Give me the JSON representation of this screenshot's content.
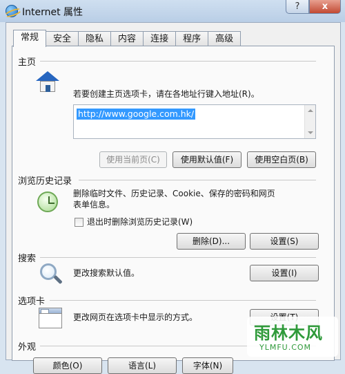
{
  "window": {
    "title": "Internet 属性"
  },
  "titlebar": {
    "help_label": "?",
    "close_label": "x"
  },
  "tabs": [
    {
      "label": "常规"
    },
    {
      "label": "安全"
    },
    {
      "label": "隐私"
    },
    {
      "label": "内容"
    },
    {
      "label": "连接"
    },
    {
      "label": "程序"
    },
    {
      "label": "高级"
    }
  ],
  "home": {
    "title": "主页",
    "description": "若要创建主页选项卡，请在各地址行键入地址(R)。",
    "url": "http://www.google.com.hk/",
    "use_current": "使用当前页(C)",
    "use_default": "使用默认值(F)",
    "use_blank": "使用空白页(B)"
  },
  "history": {
    "title": "浏览历史记录",
    "description_line1": "删除临时文件、历史记录、Cookie、保存的密码和网页",
    "description_line2": "表单信息。",
    "checkbox_label": "退出时删除浏览历史记录(W)",
    "delete_button": "删除(D)...",
    "settings_button": "设置(S)"
  },
  "search": {
    "title": "搜索",
    "description": "更改搜索默认值。",
    "settings_button": "设置(I)"
  },
  "tabs_section": {
    "title": "选项卡",
    "description": "更改网页在选项卡中显示的方式。",
    "settings_button": "设置(T)"
  },
  "appearance": {
    "title": "外观",
    "colors_button": "颜色(O)",
    "languages_button": "语言(L)",
    "fonts_button": "字体(N)"
  },
  "watermark": {
    "main": "雨林木风",
    "sub": "YLMFU.COM"
  }
}
